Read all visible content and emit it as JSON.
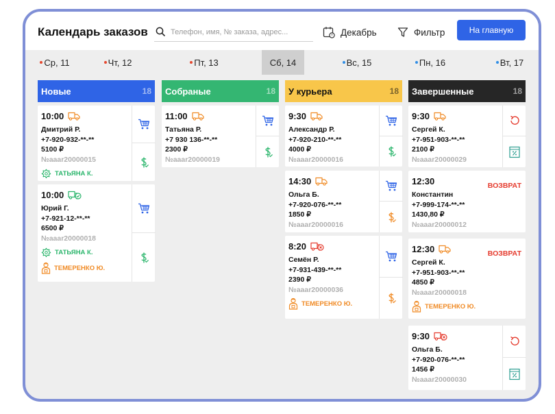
{
  "header": {
    "title": "Календарь заказов",
    "search_placeholder": "Телефон, имя, № заказа, адрес...",
    "month_label": "Декабрь",
    "filter_label": "Фильтр",
    "main_button": "На главную"
  },
  "days": [
    {
      "label": "Ср, 11",
      "dot": "#e5472e"
    },
    {
      "label": "Чт, 12",
      "dot": "#e5472e"
    },
    {
      "label": "Пт, 13",
      "dot": "#e5472e"
    },
    {
      "label": "Сб, 14",
      "dot": "",
      "active": true
    },
    {
      "label": "Вс, 15",
      "dot": "#2f8ee6"
    },
    {
      "label": "Пн, 16",
      "dot": "#2f8ee6"
    },
    {
      "label": "Вт, 17",
      "dot": "#2f8ee6"
    }
  ],
  "columns": [
    {
      "title": "Новые",
      "count": "18",
      "color": "#2f64e6",
      "text_color": "#ffffff",
      "cards": [
        {
          "time": "10:00",
          "name": "Дмитрий Р.",
          "phone": "+7-920-932-**-**",
          "price": "5100 ₽",
          "order": "№aaar20000015",
          "assignees": [
            {
              "name": "ТАТЬЯНА К.",
              "color": "#2ab56b",
              "icon": "flower-icon"
            }
          ]
        },
        {
          "time": "10:00",
          "name": "Юрий Г.",
          "phone": "+7-921-12-**-**",
          "price": "6500 ₽",
          "order": "№aaar20000018",
          "assignees": [
            {
              "name": "ТАТЬЯНА К.",
              "color": "#2ab56b",
              "icon": "flower-icon"
            },
            {
              "name": "ТЕМЕРЕНКО Ю.",
              "color": "#f08a24",
              "icon": "courier-icon"
            }
          ]
        }
      ]
    },
    {
      "title": "Собраные",
      "count": "18",
      "color": "#34b672",
      "text_color": "#ffffff",
      "cards": [
        {
          "time": "11:00",
          "name": "Татьяна Р.",
          "phone": "+7 930 136-**-**",
          "price": "2300 ₽",
          "order": "№aaar20000019",
          "assignees": []
        }
      ]
    },
    {
      "title": "У курьера",
      "count": "18",
      "color": "#f8c64a",
      "text_color": "#111111",
      "cards": [
        {
          "time": "9:30",
          "name": "Александр Р.",
          "phone": "+7-920-210-**-**",
          "price": "4000 ₽",
          "order": "№aaar20000016",
          "assignees": []
        },
        {
          "time": "14:30",
          "name": "Ольга Б.",
          "phone": "+7-920-076-**-**",
          "price": "1850 ₽",
          "order": "№aaar20000016",
          "assignees": []
        },
        {
          "time": "8:20",
          "name": "Семён Р.",
          "phone": "+7-931-439-**-**",
          "price": "2390 ₽",
          "order": "№aaar20000036",
          "assignees": [
            {
              "name": "ТЕМЕРЕНКО Ю.",
              "color": "#f08a24",
              "icon": "courier-icon"
            }
          ]
        }
      ]
    },
    {
      "title": "Завершенные",
      "count": "18",
      "color": "#262626",
      "text_color": "#ffffff",
      "cards": [
        {
          "time": "9:30",
          "name": "Сергей К.",
          "phone": "+7-951-903-**-**",
          "price": "2100 ₽",
          "order": "№aaar20000029",
          "assignees": []
        },
        {
          "time": "12:30",
          "name": "Константин",
          "phone": "+7-999-174-**-**",
          "price": "1430,80 ₽",
          "order": "№aaar20000012",
          "status": "ВОЗВРАТ",
          "assignees": []
        },
        {
          "time": "12:30",
          "name": "Сергей К.",
          "phone": "+7-951-903-**-**",
          "price": "4850 ₽",
          "order": "№aaar20000018",
          "status": "ВОЗВРАТ",
          "assignees": [
            {
              "name": "ТЕМЕРЕНКО Ю.",
              "color": "#f08a24",
              "icon": "courier-icon"
            }
          ]
        },
        {
          "time": "9:30",
          "name": "Ольга Б.",
          "phone": "+7-920-076-**-**",
          "price": "1456 ₽",
          "order": "№aaar20000030",
          "assignees": []
        }
      ]
    }
  ]
}
